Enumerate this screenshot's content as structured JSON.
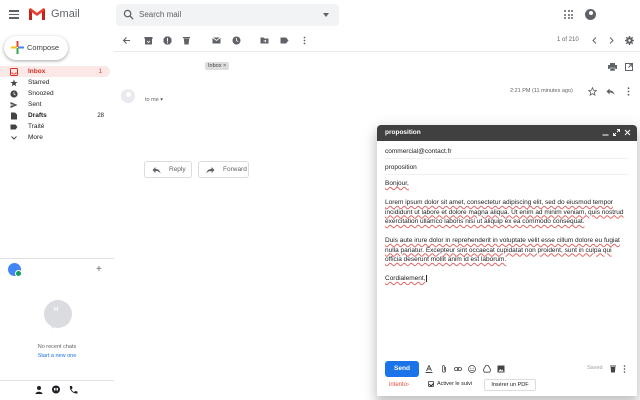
{
  "app": {
    "name": "Gmail",
    "brand_red": "#ea4335"
  },
  "search": {
    "placeholder": "Search mail"
  },
  "sidebar": {
    "compose_label": "Compose",
    "items": [
      {
        "label": "Inbox",
        "count": "1",
        "icon": "inbox-icon",
        "active": true
      },
      {
        "label": "Starred",
        "count": "",
        "icon": "star-icon"
      },
      {
        "label": "Snoozed",
        "count": "",
        "icon": "clock-icon"
      },
      {
        "label": "Sent",
        "count": "",
        "icon": "send-icon"
      },
      {
        "label": "Drafts",
        "count": "28",
        "icon": "draft-icon"
      },
      {
        "label": "Traité",
        "count": "",
        "icon": "label-icon"
      },
      {
        "label": "More",
        "count": "",
        "icon": "chevron-down-icon"
      }
    ],
    "hangouts": {
      "empty_text": "No recent chats",
      "start_link": "Start a new one"
    }
  },
  "toolbar": {
    "pager": "1 of 210"
  },
  "message": {
    "label_chip": "Inbox ×",
    "recipient": "to me ▾",
    "time": "2:21 PM (11 minutes ago)",
    "reply_label": "Reply",
    "forward_label": "Forward"
  },
  "compose": {
    "title": "proposition",
    "to": "commercial@contact.fr",
    "subject": "proposition",
    "greeting": "Bonjour,",
    "paragraph1": "Lorem ipsum dolor sit amet, consectetur adipiscing elit, sed do eiusmod tempor incididunt ut labore et dolore magna aliqua. Ut enim ad minim veniam, quis nostrud exercitation ullamco laboris nisi ut aliquip ex ea commodo consequat.",
    "paragraph2": "Duis aute irure dolor in reprehenderit in voluptate velit esse cillum dolore eu fugiat nulla pariatur. Excepteur sint occaecat cupidatat non proident, sunt in culpa qui officia deserunt mollit anim id est laborum.",
    "closing": "Cordialement,",
    "send_label": "Send",
    "saved_label": "Saved",
    "intento_label": "intento›",
    "suivi_label": "Activer le suivi",
    "pdf_label": "Insérer un PDF"
  }
}
